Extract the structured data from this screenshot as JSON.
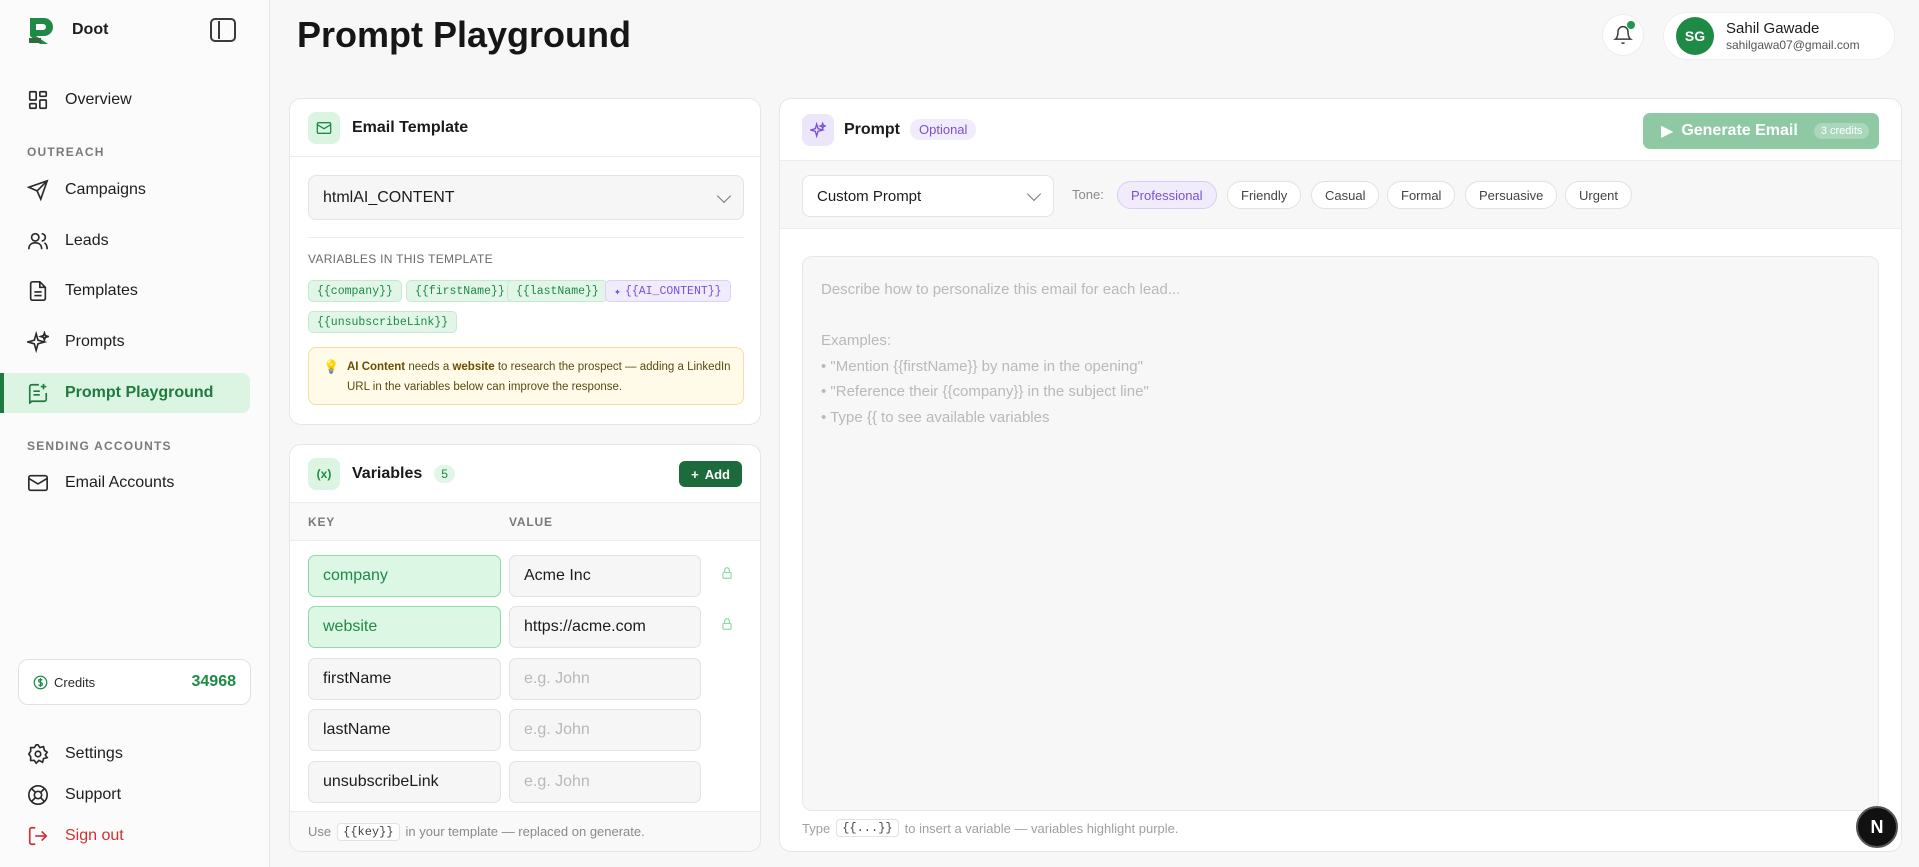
{
  "app": {
    "name": "Doot"
  },
  "sidebar": {
    "overview": "Overview",
    "outreach_label": "OUTREACH",
    "items": [
      {
        "label": "Campaigns"
      },
      {
        "label": "Leads"
      },
      {
        "label": "Templates"
      },
      {
        "label": "Prompts"
      },
      {
        "label": "Prompt Playground"
      }
    ],
    "sending_label": "SENDING ACCOUNTS",
    "email_accounts": "Email Accounts",
    "credits_label": "Credits",
    "credits_value": "34968",
    "settings": "Settings",
    "support": "Support",
    "signout": "Sign out"
  },
  "header": {
    "title": "Prompt Playground",
    "user_initials": "SG",
    "user_name": "Sahil Gawade",
    "user_email": "sahilgawa07@gmail.com"
  },
  "email_template": {
    "title": "Email Template",
    "selected": "htmlAI_CONTENT",
    "vars_label": "VARIABLES IN THIS TEMPLATE",
    "chips": [
      "{{company}}",
      "{{firstName}}",
      "{{lastName}}",
      "{{AI_CONTENT}}",
      "{{unsubscribeLink}}"
    ],
    "note_strong1": "AI Content",
    "note_mid1": " needs a ",
    "note_strong2": "website",
    "note_rest": " to research the prospect — adding a LinkedIn URL in the variables below can improve the response."
  },
  "variables": {
    "title": "Variables",
    "count": "5",
    "add_label": "Add",
    "col_key": "KEY",
    "col_value": "VALUE",
    "rows": [
      {
        "key": "company",
        "value": "Acme Inc"
      },
      {
        "key": "website",
        "value": "https://acme.com"
      },
      {
        "key": "firstName",
        "placeholder": "e.g. John"
      },
      {
        "key": "lastName",
        "placeholder": "e.g. John"
      },
      {
        "key": "unsubscribeLink",
        "placeholder": "e.g. John"
      }
    ],
    "foot_pre": "Use",
    "foot_code": "{{key}}",
    "foot_post": "in your template — replaced on generate."
  },
  "prompt": {
    "title": "Prompt",
    "optional": "Optional",
    "generate_label": "Generate Email",
    "generate_credits": "3 credits",
    "custom_select": "Custom Prompt",
    "tone_label": "Tone:",
    "tones": [
      "Professional",
      "Friendly",
      "Casual",
      "Formal",
      "Persuasive",
      "Urgent"
    ],
    "selected_tone": "Professional",
    "placeholder": "Describe how to personalize this email for each lead...\n\nExamples:\n• \"Mention {{firstName}} by name in the opening\"\n• \"Reference their {{company}} in the subject line\"\n• Type {{ to see available variables",
    "foot_pre": "Type",
    "foot_code": "{{...}}",
    "foot_post": "to insert a variable — variables highlight purple."
  },
  "floating_badge": "N"
}
